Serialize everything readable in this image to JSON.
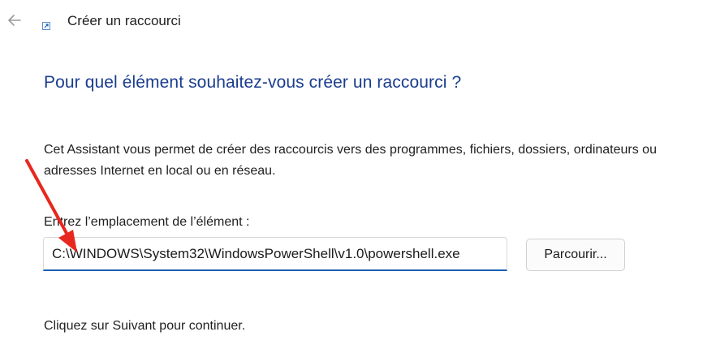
{
  "window": {
    "title": "Créer un raccourci"
  },
  "main": {
    "heading": "Pour quel élément souhaitez-vous créer un raccourci ?",
    "description": "Cet Assistant vous permet de créer des raccourcis vers des programmes, fichiers, dossiers, ordinateurs ou adresses Internet en local ou en réseau.",
    "location_label": "Entrez l’emplacement de l’élément :",
    "location_value": "C:\\WINDOWS\\System32\\WindowsPowerShell\\v1.0\\powershell.exe",
    "browse_label": "Parcourir...",
    "footer": "Cliquez sur Suivant pour continuer."
  },
  "icons": {
    "back": "back-arrow-icon",
    "app": "shortcut-icon"
  },
  "colors": {
    "heading": "#1a3d8f",
    "input_underline": "#1a5fb4",
    "annotation_arrow": "#e8271e"
  }
}
